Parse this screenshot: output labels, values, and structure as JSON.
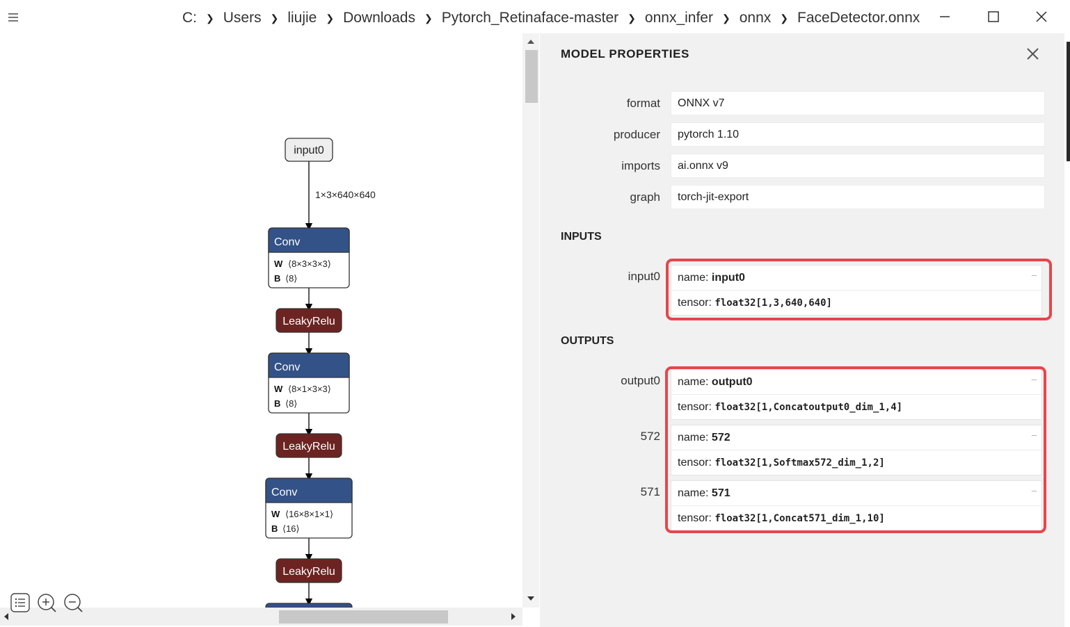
{
  "breadcrumb": [
    "C:",
    "Users",
    "liujie",
    "Downloads",
    "Pytorch_Retinaface-master",
    "onnx_infer",
    "onnx",
    "FaceDetector.onnx"
  ],
  "graph": {
    "input_node": "input0",
    "edge_label": "1×3×640×640",
    "nodes": [
      {
        "op": "Conv",
        "w_label": "W",
        "w": "⟨8×3×3×3⟩",
        "b_label": "B",
        "b": "⟨8⟩"
      },
      {
        "op": "LeakyRelu"
      },
      {
        "op": "Conv",
        "w_label": "W",
        "w": "⟨8×1×3×3⟩",
        "b_label": "B",
        "b": "⟨8⟩"
      },
      {
        "op": "LeakyRelu"
      },
      {
        "op": "Conv",
        "w_label": "W",
        "w": "⟨16×8×1×1⟩",
        "b_label": "B",
        "b": "⟨16⟩"
      },
      {
        "op": "LeakyRelu"
      }
    ],
    "colors": {
      "conv": "#335287",
      "relu": "#6b2421",
      "input_fill": "#eeeeee"
    }
  },
  "panel": {
    "title": "MODEL PROPERTIES",
    "properties": [
      {
        "label": "format",
        "value": "ONNX v7"
      },
      {
        "label": "producer",
        "value": "pytorch 1.10"
      },
      {
        "label": "imports",
        "value": "ai.onnx v9"
      },
      {
        "label": "graph",
        "value": "torch-jit-export"
      }
    ],
    "inputs_heading": "INPUTS",
    "outputs_heading": "OUTPUTS",
    "name_prefix": "name:",
    "tensor_prefix": "tensor:",
    "expander": "–",
    "inputs": [
      {
        "label": "input0",
        "name": "input0",
        "tensor": "float32[1,3,640,640]"
      }
    ],
    "outputs": [
      {
        "label": "output0",
        "name": "output0",
        "tensor": "float32[1,Concatoutput0_dim_1,4]"
      },
      {
        "label": "572",
        "name": "572",
        "tensor": "float32[1,Softmax572_dim_1,2]"
      },
      {
        "label": "571",
        "name": "571",
        "tensor": "float32[1,Concat571_dim_1,10]"
      }
    ],
    "highlight_color": "#e5464c"
  }
}
